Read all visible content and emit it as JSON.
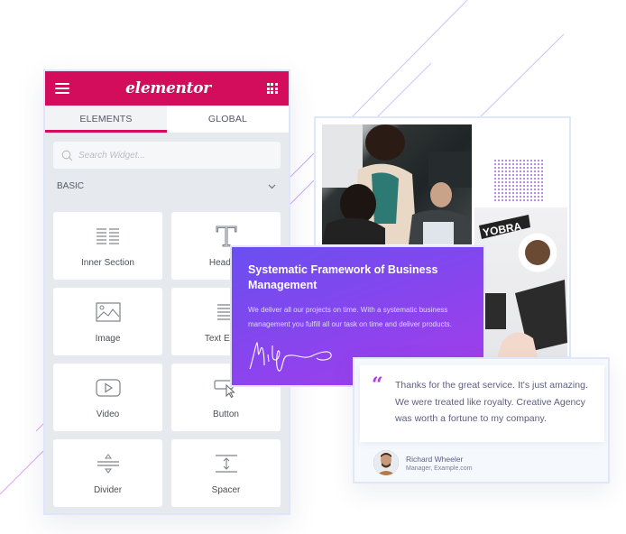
{
  "panel": {
    "brand": "elementor",
    "tabs": [
      {
        "label": "ELEMENTS",
        "active": true
      },
      {
        "label": "GLOBAL",
        "active": false
      }
    ],
    "search_placeholder": "Search Widget...",
    "category": "BASIC",
    "widgets": [
      {
        "label": "Inner Section",
        "icon": "inner-section-icon"
      },
      {
        "label": "Heading",
        "icon": "heading-icon"
      },
      {
        "label": "Image",
        "icon": "image-icon"
      },
      {
        "label": "Text Editor",
        "icon": "text-editor-icon"
      },
      {
        "label": "Video",
        "icon": "video-icon"
      },
      {
        "label": "Button",
        "icon": "button-icon"
      },
      {
        "label": "Divider",
        "icon": "divider-icon"
      },
      {
        "label": "Spacer",
        "icon": "spacer-icon"
      }
    ]
  },
  "feature_card": {
    "title": "Systematic Framework of Business Management",
    "body": "We deliver all our projects on time. With a systematic business management you fulfill all our task on time and deliver products."
  },
  "testimonial": {
    "quote_mark": "“",
    "text": "Thanks for the great service. It's just amazing. We were treated like royalty. Creative Agency was worth a fortune to my company.",
    "author": "Richard Wheeler",
    "role": "Manager, Example.com"
  },
  "colors": {
    "brand": "#d30c5c",
    "accent_purple": "#8a44ee",
    "quote": "#b536e6"
  }
}
